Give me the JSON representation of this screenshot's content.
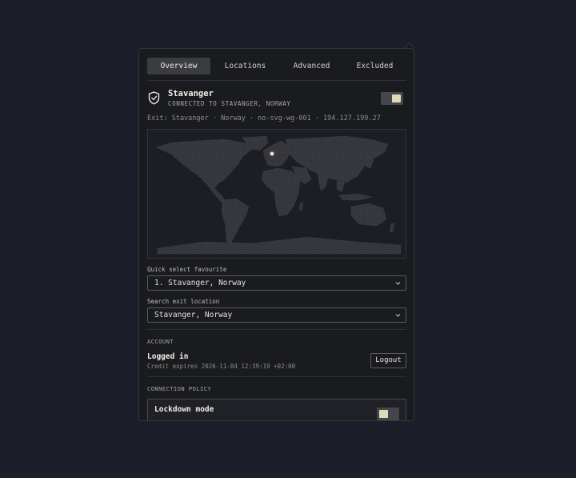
{
  "tabs": [
    {
      "label": "Overview",
      "active": true
    },
    {
      "label": "Locations",
      "active": false
    },
    {
      "label": "Advanced",
      "active": false
    },
    {
      "label": "Excluded",
      "active": false
    }
  ],
  "connection": {
    "icon": "shield-check-icon",
    "title": "Stavanger",
    "subtitle": "CONNECTED TO STAVANGER, NORWAY",
    "enabled": true,
    "exit_line": "Exit: Stavanger · Norway · no-svg-wg-001 · 194.127.199.27"
  },
  "quick_select": {
    "label": "Quick select favourite",
    "value": "1. Stavanger, Norway"
  },
  "search_exit": {
    "label": "Search exit location",
    "value": "Stavanger, Norway"
  },
  "account": {
    "section_title": "ACCOUNT",
    "status": "Logged in",
    "credit": "Credit expires 2026-11-04 12:39:19 +02:00",
    "logout_label": "Logout"
  },
  "policy": {
    "section_title": "CONNECTION POLICY",
    "lockdown_label": "Lockdown mode",
    "lockdown_enabled": false
  },
  "colors": {
    "background": "#1c1f29",
    "panel": "#1a1b1f",
    "toggle_knob": "#dedcb8",
    "map_land": "#3a3b40",
    "location_marker": "#f4f0d8"
  }
}
